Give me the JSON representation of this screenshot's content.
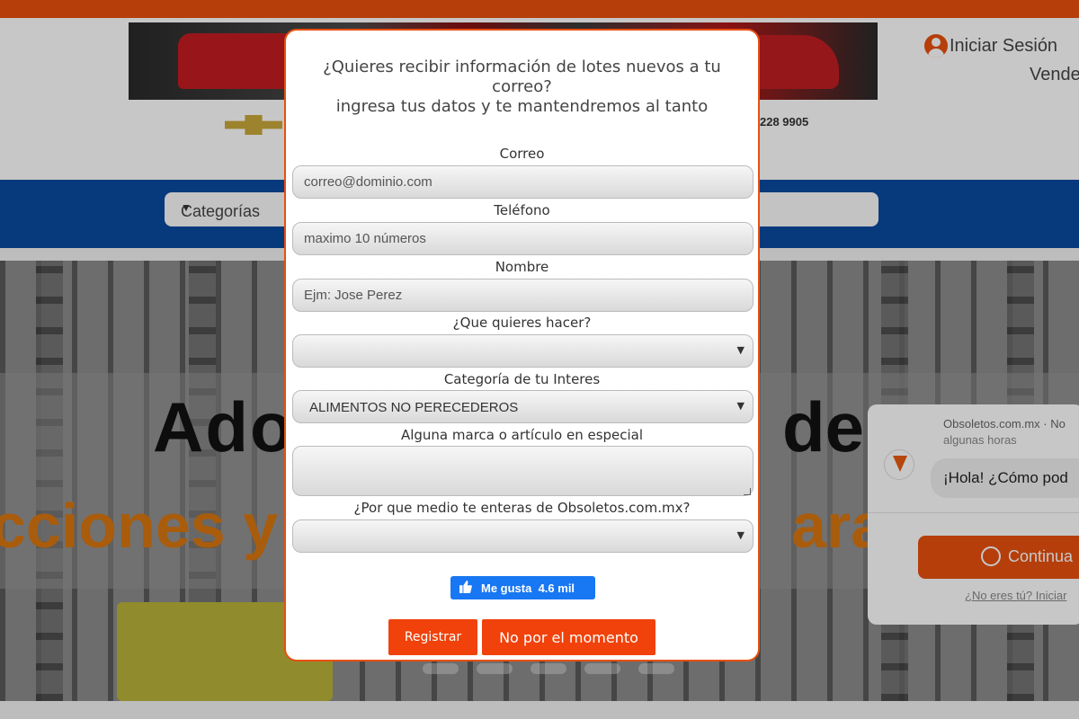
{
  "header": {
    "phone": "228 9905",
    "login_label": "Iniciar Sesión",
    "sell_label": "Vende"
  },
  "nav": {
    "categories_select": "Categorías"
  },
  "hero": {
    "title_left": "Ado",
    "title_right": "de",
    "subtitle_left": "cciones y",
    "subtitle_right": "ara"
  },
  "messenger": {
    "page_name": "Obsoletos.com.mx · No",
    "meta": "algunas horas",
    "greeting": "¡Hola! ¿Cómo pod",
    "cta_label": "Continua",
    "not_you": "¿No eres tú? Iniciar"
  },
  "modal": {
    "title_line1": "¿Quieres recibir información de lotes nuevos a tu",
    "title_line2": "correo?",
    "title_line3": "ingresa tus datos y te mantendremos al tanto",
    "email_label": "Correo",
    "email_placeholder": "correo@dominio.com",
    "phone_label": "Teléfono",
    "phone_placeholder": "maximo 10 números",
    "name_label": "Nombre",
    "name_placeholder": "Ejm: Jose Perez",
    "action_label": "¿Que quieres hacer?",
    "action_value": "",
    "category_label": "Categoría de tu Interes",
    "category_value": "ALIMENTOS NO PERECEDEROS",
    "brand_label": "Alguna marca o artículo en especial",
    "source_label": "¿Por que medio te enteras de Obsoletos.com.mx?",
    "source_value": "",
    "like_label": "Me gusta",
    "like_count": "4.6 mil",
    "register_button": "Registrar",
    "dismiss_button": "No por el momento"
  },
  "colors": {
    "accent": "#e8500f",
    "nav_blue": "#0a4aa0",
    "facebook_blue": "#1877f2"
  }
}
